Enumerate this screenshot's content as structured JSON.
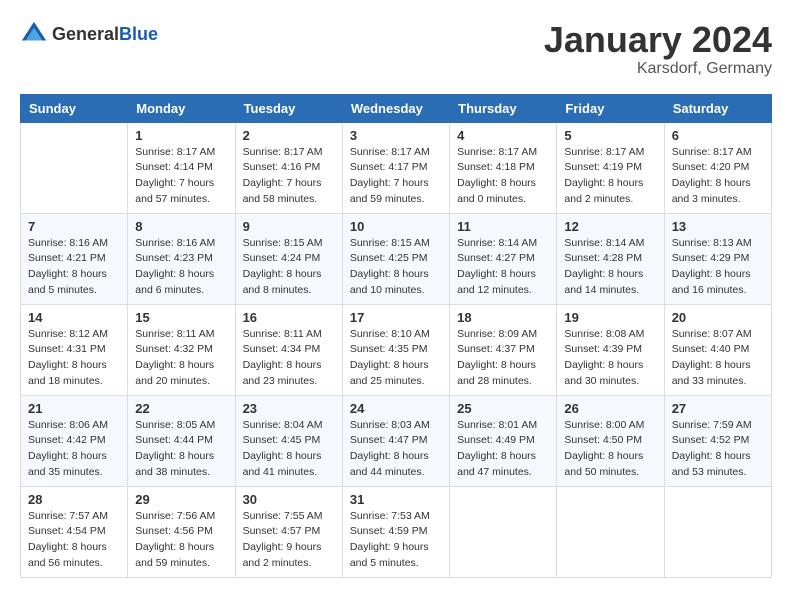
{
  "header": {
    "logo_general": "General",
    "logo_blue": "Blue",
    "title": "January 2024",
    "subtitle": "Karsdorf, Germany"
  },
  "weekdays": [
    "Sunday",
    "Monday",
    "Tuesday",
    "Wednesday",
    "Thursday",
    "Friday",
    "Saturday"
  ],
  "weeks": [
    [
      {
        "day": "",
        "sunrise": "",
        "sunset": "",
        "daylight": ""
      },
      {
        "day": "1",
        "sunrise": "Sunrise: 8:17 AM",
        "sunset": "Sunset: 4:14 PM",
        "daylight": "Daylight: 7 hours and 57 minutes."
      },
      {
        "day": "2",
        "sunrise": "Sunrise: 8:17 AM",
        "sunset": "Sunset: 4:16 PM",
        "daylight": "Daylight: 7 hours and 58 minutes."
      },
      {
        "day": "3",
        "sunrise": "Sunrise: 8:17 AM",
        "sunset": "Sunset: 4:17 PM",
        "daylight": "Daylight: 7 hours and 59 minutes."
      },
      {
        "day": "4",
        "sunrise": "Sunrise: 8:17 AM",
        "sunset": "Sunset: 4:18 PM",
        "daylight": "Daylight: 8 hours and 0 minutes."
      },
      {
        "day": "5",
        "sunrise": "Sunrise: 8:17 AM",
        "sunset": "Sunset: 4:19 PM",
        "daylight": "Daylight: 8 hours and 2 minutes."
      },
      {
        "day": "6",
        "sunrise": "Sunrise: 8:17 AM",
        "sunset": "Sunset: 4:20 PM",
        "daylight": "Daylight: 8 hours and 3 minutes."
      }
    ],
    [
      {
        "day": "7",
        "sunrise": "Sunrise: 8:16 AM",
        "sunset": "Sunset: 4:21 PM",
        "daylight": "Daylight: 8 hours and 5 minutes."
      },
      {
        "day": "8",
        "sunrise": "Sunrise: 8:16 AM",
        "sunset": "Sunset: 4:23 PM",
        "daylight": "Daylight: 8 hours and 6 minutes."
      },
      {
        "day": "9",
        "sunrise": "Sunrise: 8:15 AM",
        "sunset": "Sunset: 4:24 PM",
        "daylight": "Daylight: 8 hours and 8 minutes."
      },
      {
        "day": "10",
        "sunrise": "Sunrise: 8:15 AM",
        "sunset": "Sunset: 4:25 PM",
        "daylight": "Daylight: 8 hours and 10 minutes."
      },
      {
        "day": "11",
        "sunrise": "Sunrise: 8:14 AM",
        "sunset": "Sunset: 4:27 PM",
        "daylight": "Daylight: 8 hours and 12 minutes."
      },
      {
        "day": "12",
        "sunrise": "Sunrise: 8:14 AM",
        "sunset": "Sunset: 4:28 PM",
        "daylight": "Daylight: 8 hours and 14 minutes."
      },
      {
        "day": "13",
        "sunrise": "Sunrise: 8:13 AM",
        "sunset": "Sunset: 4:29 PM",
        "daylight": "Daylight: 8 hours and 16 minutes."
      }
    ],
    [
      {
        "day": "14",
        "sunrise": "Sunrise: 8:12 AM",
        "sunset": "Sunset: 4:31 PM",
        "daylight": "Daylight: 8 hours and 18 minutes."
      },
      {
        "day": "15",
        "sunrise": "Sunrise: 8:11 AM",
        "sunset": "Sunset: 4:32 PM",
        "daylight": "Daylight: 8 hours and 20 minutes."
      },
      {
        "day": "16",
        "sunrise": "Sunrise: 8:11 AM",
        "sunset": "Sunset: 4:34 PM",
        "daylight": "Daylight: 8 hours and 23 minutes."
      },
      {
        "day": "17",
        "sunrise": "Sunrise: 8:10 AM",
        "sunset": "Sunset: 4:35 PM",
        "daylight": "Daylight: 8 hours and 25 minutes."
      },
      {
        "day": "18",
        "sunrise": "Sunrise: 8:09 AM",
        "sunset": "Sunset: 4:37 PM",
        "daylight": "Daylight: 8 hours and 28 minutes."
      },
      {
        "day": "19",
        "sunrise": "Sunrise: 8:08 AM",
        "sunset": "Sunset: 4:39 PM",
        "daylight": "Daylight: 8 hours and 30 minutes."
      },
      {
        "day": "20",
        "sunrise": "Sunrise: 8:07 AM",
        "sunset": "Sunset: 4:40 PM",
        "daylight": "Daylight: 8 hours and 33 minutes."
      }
    ],
    [
      {
        "day": "21",
        "sunrise": "Sunrise: 8:06 AM",
        "sunset": "Sunset: 4:42 PM",
        "daylight": "Daylight: 8 hours and 35 minutes."
      },
      {
        "day": "22",
        "sunrise": "Sunrise: 8:05 AM",
        "sunset": "Sunset: 4:44 PM",
        "daylight": "Daylight: 8 hours and 38 minutes."
      },
      {
        "day": "23",
        "sunrise": "Sunrise: 8:04 AM",
        "sunset": "Sunset: 4:45 PM",
        "daylight": "Daylight: 8 hours and 41 minutes."
      },
      {
        "day": "24",
        "sunrise": "Sunrise: 8:03 AM",
        "sunset": "Sunset: 4:47 PM",
        "daylight": "Daylight: 8 hours and 44 minutes."
      },
      {
        "day": "25",
        "sunrise": "Sunrise: 8:01 AM",
        "sunset": "Sunset: 4:49 PM",
        "daylight": "Daylight: 8 hours and 47 minutes."
      },
      {
        "day": "26",
        "sunrise": "Sunrise: 8:00 AM",
        "sunset": "Sunset: 4:50 PM",
        "daylight": "Daylight: 8 hours and 50 minutes."
      },
      {
        "day": "27",
        "sunrise": "Sunrise: 7:59 AM",
        "sunset": "Sunset: 4:52 PM",
        "daylight": "Daylight: 8 hours and 53 minutes."
      }
    ],
    [
      {
        "day": "28",
        "sunrise": "Sunrise: 7:57 AM",
        "sunset": "Sunset: 4:54 PM",
        "daylight": "Daylight: 8 hours and 56 minutes."
      },
      {
        "day": "29",
        "sunrise": "Sunrise: 7:56 AM",
        "sunset": "Sunset: 4:56 PM",
        "daylight": "Daylight: 8 hours and 59 minutes."
      },
      {
        "day": "30",
        "sunrise": "Sunrise: 7:55 AM",
        "sunset": "Sunset: 4:57 PM",
        "daylight": "Daylight: 9 hours and 2 minutes."
      },
      {
        "day": "31",
        "sunrise": "Sunrise: 7:53 AM",
        "sunset": "Sunset: 4:59 PM",
        "daylight": "Daylight: 9 hours and 5 minutes."
      },
      {
        "day": "",
        "sunrise": "",
        "sunset": "",
        "daylight": ""
      },
      {
        "day": "",
        "sunrise": "",
        "sunset": "",
        "daylight": ""
      },
      {
        "day": "",
        "sunrise": "",
        "sunset": "",
        "daylight": ""
      }
    ]
  ]
}
